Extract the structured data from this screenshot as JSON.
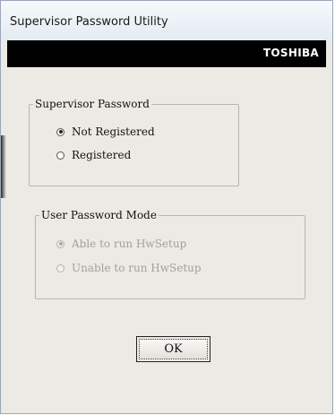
{
  "window": {
    "title": "Supervisor Password Utility"
  },
  "banner": {
    "brand": "TOSHIBA"
  },
  "supervisor_password": {
    "legend": "Supervisor Password",
    "options": [
      {
        "label": "Not Registered",
        "selected": true,
        "enabled": true
      },
      {
        "label": "Registered",
        "selected": false,
        "enabled": true
      }
    ]
  },
  "user_password_mode": {
    "legend": "User Password Mode",
    "options": [
      {
        "label": "Able to run HwSetup",
        "selected": true,
        "enabled": false
      },
      {
        "label": "Unable to run HwSetup",
        "selected": false,
        "enabled": false
      }
    ]
  },
  "buttons": {
    "ok": "OK"
  }
}
